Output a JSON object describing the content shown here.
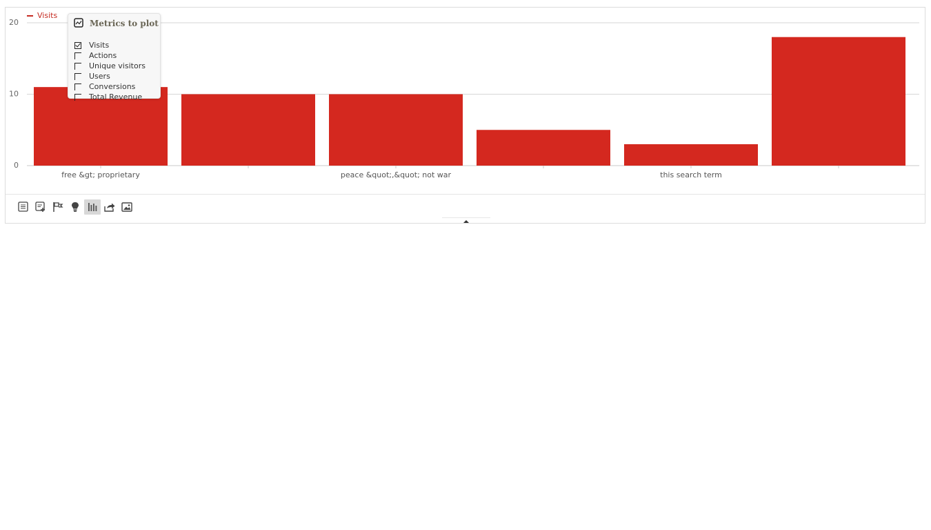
{
  "colors": {
    "bar": "#d4281f",
    "legend": "#c52b22",
    "grid": "#d6d6d6",
    "axis": "#c9c9c9"
  },
  "metric_picker": {
    "title": "Metrics to plot",
    "options": [
      {
        "label": "Visits",
        "checked": true
      },
      {
        "label": "Actions",
        "checked": false
      },
      {
        "label": "Unique visitors",
        "checked": false
      },
      {
        "label": "Users",
        "checked": false
      },
      {
        "label": "Conversions",
        "checked": false
      },
      {
        "label": "Total Revenue",
        "checked": false
      }
    ]
  },
  "toolbar": {
    "buttons": [
      {
        "icon": "table-icon",
        "active": false
      },
      {
        "icon": "table-more-columns-icon",
        "active": false
      },
      {
        "icon": "goals-flag-icon",
        "active": false
      },
      {
        "icon": "insights-lightbulb-icon",
        "active": false
      },
      {
        "icon": "bar-chart-icon",
        "active": true
      },
      {
        "icon": "export-share-icon",
        "active": false
      },
      {
        "icon": "image-icon",
        "active": false
      }
    ]
  },
  "chart_data": {
    "type": "bar",
    "categories": [
      "free &gt; proprietary",
      "",
      "peace &quot;,&quot; not war",
      "",
      "this search term",
      ""
    ],
    "series": [
      {
        "name": "Visits",
        "values": [
          11,
          10,
          10,
          5,
          3,
          18
        ]
      }
    ],
    "yticks": [
      0,
      10,
      20
    ],
    "ylim": [
      0,
      20
    ],
    "legend": "top-left",
    "grid": true
  }
}
